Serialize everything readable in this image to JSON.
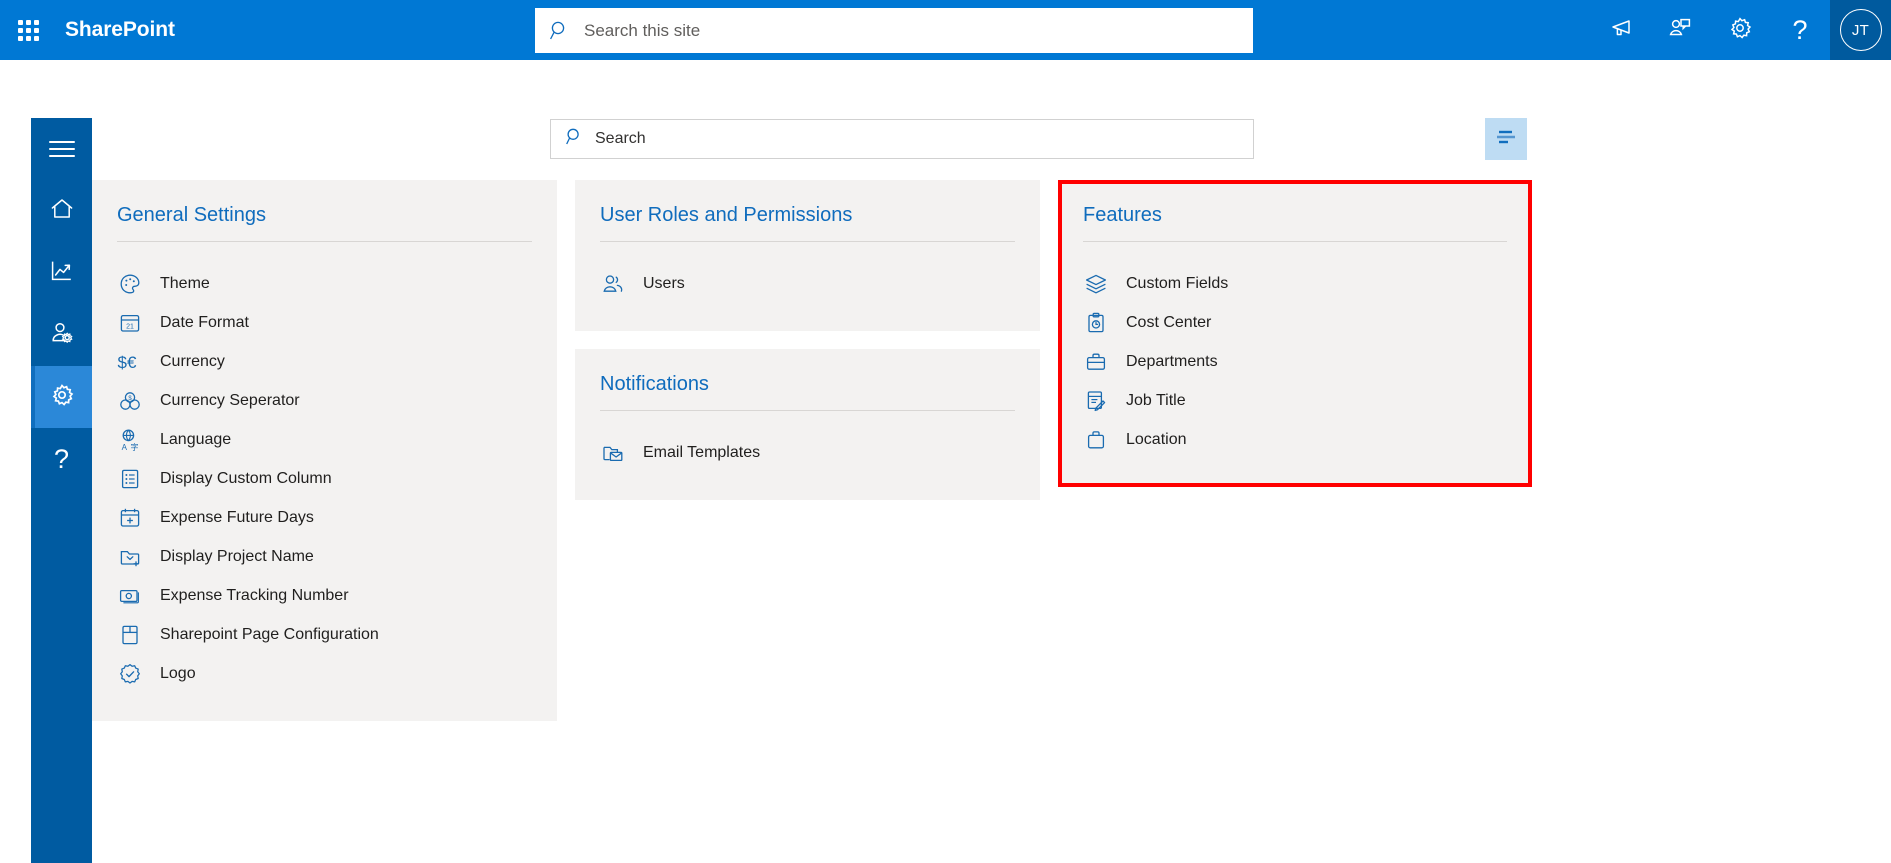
{
  "suite": {
    "brand": "SharePoint",
    "waffle_icon": "app-launcher-icon",
    "search": {
      "placeholder": "Search this site",
      "value": "",
      "icon": "search-icon"
    },
    "actions": [
      {
        "name": "announcements-icon",
        "label": "Announcements"
      },
      {
        "name": "meet-now-icon",
        "label": "Meet now"
      },
      {
        "name": "settings-gear-icon",
        "label": "Settings"
      },
      {
        "name": "help-icon",
        "label": "Help"
      }
    ],
    "avatar": {
      "initials": "JT",
      "bg": "#005a9e"
    },
    "bg": "#0078d4"
  },
  "rail": {
    "bg": "#005ba1",
    "active_bg": "#2b88d8",
    "items": [
      {
        "name": "hamburger-menu-icon",
        "label": "Menu",
        "active": false
      },
      {
        "name": "home-icon",
        "label": "Home",
        "active": false
      },
      {
        "name": "analytics-icon",
        "label": "Analytics",
        "active": false
      },
      {
        "name": "user-settings-icon",
        "label": "User Settings",
        "active": false
      },
      {
        "name": "settings-gear-icon",
        "label": "Settings",
        "active": true
      },
      {
        "name": "help-icon",
        "label": "Help",
        "active": false
      }
    ]
  },
  "page": {
    "search": {
      "placeholder": "Search",
      "value": "",
      "icon": "search-icon"
    },
    "filter_button": {
      "icon": "filter-lines-icon",
      "label": "Filter",
      "bg": "#bedcf3"
    },
    "highlight_color": "#ff0000",
    "card_bg": "#f3f2f1",
    "title_color": "#0f6cbd"
  },
  "cards": {
    "general_settings": {
      "title": "General Settings",
      "highlighted": false,
      "items": [
        {
          "label": "Theme",
          "icon": "palette-icon"
        },
        {
          "label": "Date Format",
          "icon": "calendar-icon"
        },
        {
          "label": "Currency",
          "icon": "currency-icon"
        },
        {
          "label": "Currency Seperator",
          "icon": "coins-icon"
        },
        {
          "label": "Language",
          "icon": "translate-icon"
        },
        {
          "label": "Display Custom Column",
          "icon": "list-icon"
        },
        {
          "label": "Expense Future Days",
          "icon": "calendar-add-icon"
        },
        {
          "label": "Display Project Name",
          "icon": "folder-add-icon"
        },
        {
          "label": "Expense Tracking Number",
          "icon": "money-icon"
        },
        {
          "label": "Sharepoint Page Configuration",
          "icon": "page-icon"
        },
        {
          "label": "Logo",
          "icon": "badge-check-icon"
        }
      ]
    },
    "user_roles": {
      "title": "User Roles and Permissions",
      "highlighted": false,
      "items": [
        {
          "label": "Users",
          "icon": "people-icon"
        }
      ]
    },
    "notifications": {
      "title": "Notifications",
      "highlighted": false,
      "items": [
        {
          "label": "Email Templates",
          "icon": "mail-folder-icon"
        }
      ]
    },
    "features": {
      "title": "Features",
      "highlighted": true,
      "items": [
        {
          "label": "Custom Fields",
          "icon": "layers-icon"
        },
        {
          "label": "Cost Center",
          "icon": "clipboard-clock-icon"
        },
        {
          "label": "Departments",
          "icon": "briefcase-icon"
        },
        {
          "label": "Job Title",
          "icon": "document-edit-icon"
        },
        {
          "label": "Location",
          "icon": "suitcase-icon"
        }
      ]
    }
  }
}
